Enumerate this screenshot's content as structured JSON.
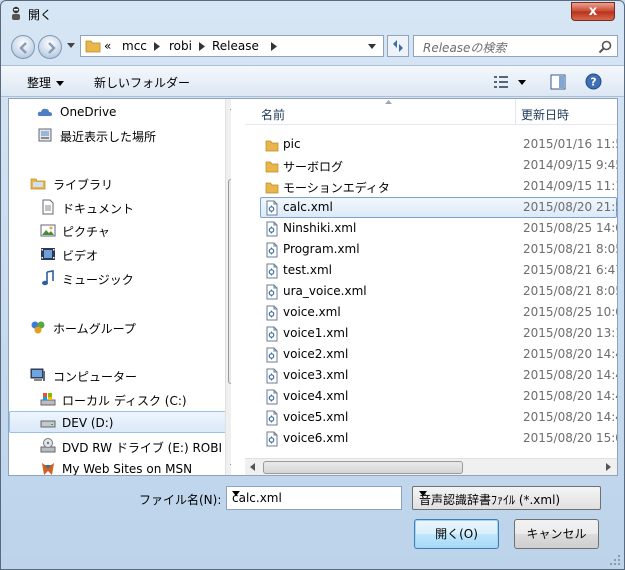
{
  "window": {
    "title": "開く",
    "close_label": "x"
  },
  "address": {
    "overflow": "«",
    "segments": [
      "mcc",
      "robi",
      "Release"
    ]
  },
  "search": {
    "placeholder": "Releaseの検索"
  },
  "toolbar": {
    "organize_label": "整理",
    "new_folder_label": "新しいフォルダー"
  },
  "nav": {
    "items": [
      {
        "label": "OneDrive",
        "icon": "cloud-icon"
      },
      {
        "label": "最近表示した場所",
        "icon": "recent-places-icon"
      },
      {
        "label": "ライブラリ",
        "icon": "libraries-icon"
      },
      {
        "label": "ドキュメント",
        "icon": "documents-icon"
      },
      {
        "label": "ピクチャ",
        "icon": "pictures-icon"
      },
      {
        "label": "ビデオ",
        "icon": "videos-icon"
      },
      {
        "label": "ミュージック",
        "icon": "music-icon"
      },
      {
        "label": "ホームグループ",
        "icon": "homegroup-icon"
      },
      {
        "label": "コンピューター",
        "icon": "computer-icon"
      },
      {
        "label": "ローカル ディスク (C:)",
        "icon": "local-disk-icon"
      },
      {
        "label": "DEV (D:)",
        "icon": "drive-icon"
      },
      {
        "label": "DVD RW ドライブ (E:) ROBI",
        "icon": "dvd-drive-icon"
      },
      {
        "label": "My Web Sites on MSN",
        "icon": "web-sites-icon"
      }
    ],
    "selected_label": "DEV (D:)"
  },
  "columns": {
    "name": "名前",
    "date": "更新日時"
  },
  "files": [
    {
      "name": "pic",
      "date": "2015/01/16 11:5",
      "type": "folder"
    },
    {
      "name": "サーボログ",
      "date": "2014/09/15 9:45",
      "type": "folder"
    },
    {
      "name": "モーションエディタ",
      "date": "2014/09/15 11:1",
      "type": "folder"
    },
    {
      "name": "calc.xml",
      "date": "2015/08/20 21:5",
      "type": "xml"
    },
    {
      "name": "Ninshiki.xml",
      "date": "2015/08/25 14:0",
      "type": "xml"
    },
    {
      "name": "Program.xml",
      "date": "2015/08/21 8:05",
      "type": "xml"
    },
    {
      "name": "test.xml",
      "date": "2015/08/21 6:47",
      "type": "xml"
    },
    {
      "name": "ura_voice.xml",
      "date": "2015/08/21 8:05",
      "type": "xml"
    },
    {
      "name": "voice.xml",
      "date": "2015/08/25 10:0",
      "type": "xml"
    },
    {
      "name": "voice1.xml",
      "date": "2015/08/20 13:1",
      "type": "xml"
    },
    {
      "name": "voice2.xml",
      "date": "2015/08/20 14:4",
      "type": "xml"
    },
    {
      "name": "voice3.xml",
      "date": "2015/08/20 14:4",
      "type": "xml"
    },
    {
      "name": "voice4.xml",
      "date": "2015/08/20 14:4",
      "type": "xml"
    },
    {
      "name": "voice5.xml",
      "date": "2015/08/20 14:4",
      "type": "xml"
    },
    {
      "name": "voice6.xml",
      "date": "2015/08/20 15:0",
      "type": "xml"
    }
  ],
  "selected_file": "calc.xml",
  "footer": {
    "filename_label": "ファイル名(N):",
    "filename_value": "calc.xml",
    "filetype_value": "音声認識辞書ﾌｧｲﾙ (*.xml)",
    "open_label": "開く(O)",
    "cancel_label": "キャンセル"
  },
  "colors": {
    "folder": "#e8b64a",
    "selection_border": "#7da2ce",
    "frame": "#bcd3ea"
  }
}
